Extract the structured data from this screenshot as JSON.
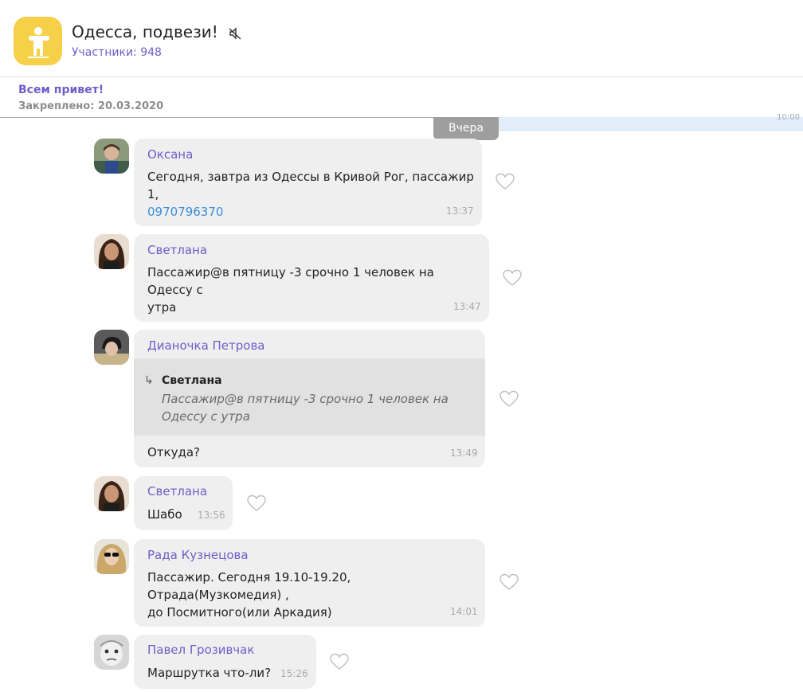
{
  "header": {
    "title": "Одесса, подвези!",
    "members": "Участники: 948"
  },
  "pinned": {
    "title": "Всем привет!",
    "date": "Закреплено: 20.03.2020"
  },
  "date_chip": "Вчера",
  "right_strip_time": "10:00",
  "messages": [
    {
      "sender": "Оксана",
      "text": "Сегодня, завтра из Одессы в Кривой Рог, пассажир 1,",
      "link": "0970796370",
      "time": "13:37"
    },
    {
      "sender": "Светлана",
      "line1": "Пассажир@в пятницу -3 срочно 1 человек на Одессу с",
      "line2": "утра",
      "time": "13:47"
    },
    {
      "sender": "Дианочка Петрова",
      "quote_sender": "Светлана",
      "quote_line1": "Пассажир@в пятницу -3 срочно 1 человек на",
      "quote_line2": "Одессу с утра",
      "text": "Откуда?",
      "time": "13:49"
    },
    {
      "sender": "Светлана",
      "text": "Шабо",
      "time": "13:56"
    },
    {
      "sender": "Рада Кузнецова",
      "line1": "Пассажир. Сегодня 19.10-19.20, Отрада(Музкомедия) ,",
      "line2": "до Посмитного(или Аркадия)",
      "time": "14:01"
    },
    {
      "sender": "Павел Грозивчак",
      "text": "Маршрутка что-ли?",
      "time": "15:26"
    }
  ],
  "colors": {
    "accent": "#6f5dc8",
    "bubble": "#efefef",
    "link": "#3a8dd8",
    "group_avatar": "#f7d04a"
  }
}
